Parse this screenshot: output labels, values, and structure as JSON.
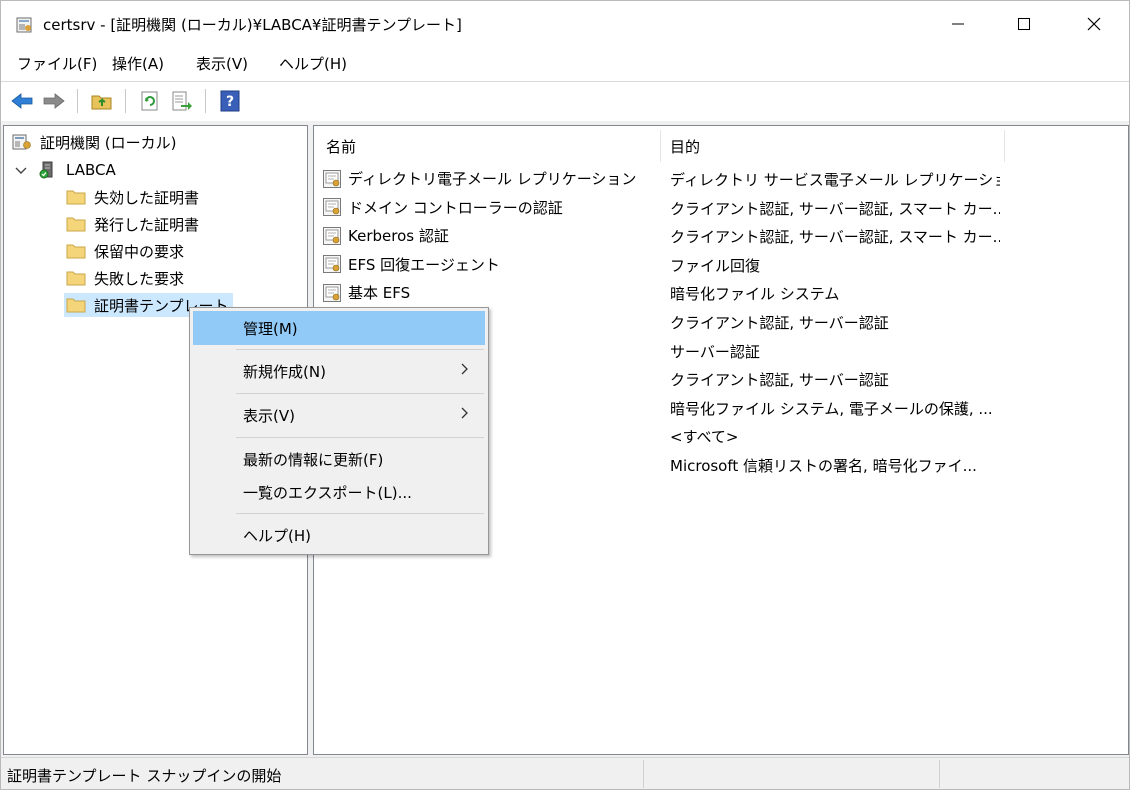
{
  "window": {
    "title": "certsrv - [証明機関 (ローカル)¥LABCA¥証明書テンプレート]"
  },
  "menubar": {
    "items": [
      {
        "label": "ファイル(F)"
      },
      {
        "label": "操作(A)"
      },
      {
        "label": "表示(V)"
      },
      {
        "label": "ヘルプ(H)"
      }
    ]
  },
  "toolbar": {
    "icons": [
      "back-icon",
      "forward-icon",
      "up-folder-icon",
      "refresh-icon",
      "export-list-icon",
      "help-icon"
    ]
  },
  "tree": {
    "root": "証明機関 (ローカル)",
    "ca": "LABCA",
    "children": [
      {
        "label": "失効した証明書"
      },
      {
        "label": "発行した証明書"
      },
      {
        "label": "保留中の要求"
      },
      {
        "label": "失敗した要求"
      },
      {
        "label": "証明書テンプレート"
      }
    ]
  },
  "list": {
    "headers": {
      "name": "名前",
      "purpose": "目的"
    },
    "rows": [
      {
        "name": "ディレクトリ電子メール レプリケーション",
        "purpose": "ディレクトリ サービス電子メール レプリケーション"
      },
      {
        "name": "ドメイン コントローラーの認証",
        "purpose": "クライアント認証, サーバー認証, スマート カー..."
      },
      {
        "name": "Kerberos 認証",
        "purpose": "クライアント認証, サーバー認証, スマート カー..."
      },
      {
        "name": "EFS 回復エージェント",
        "purpose": "ファイル回復"
      },
      {
        "name": "基本 EFS",
        "purpose": "暗号化ファイル システム"
      },
      {
        "name": "",
        "purpose": "クライアント認証, サーバー認証"
      },
      {
        "name": "",
        "purpose": "サーバー認証"
      },
      {
        "name": "",
        "purpose": "クライアント認証, サーバー認証"
      },
      {
        "name": "",
        "purpose": "暗号化ファイル システム, 電子メールの保護, ..."
      },
      {
        "name": "",
        "purpose": "<すべて>"
      },
      {
        "name": "",
        "purpose": "Microsoft 信頼リストの署名, 暗号化ファイ..."
      }
    ]
  },
  "context_menu": {
    "items": {
      "manage": "管理(M)",
      "new": "新規作成(N)",
      "view": "表示(V)",
      "refresh": "最新の情報に更新(F)",
      "export": "一覧のエクスポート(L)...",
      "help": "ヘルプ(H)"
    }
  },
  "statusbar": {
    "text": "証明書テンプレート スナップインの開始"
  },
  "colors": {
    "selection": "#cce8ff",
    "menu_highlight": "#91c9f7",
    "folder": "#f5d57a"
  }
}
